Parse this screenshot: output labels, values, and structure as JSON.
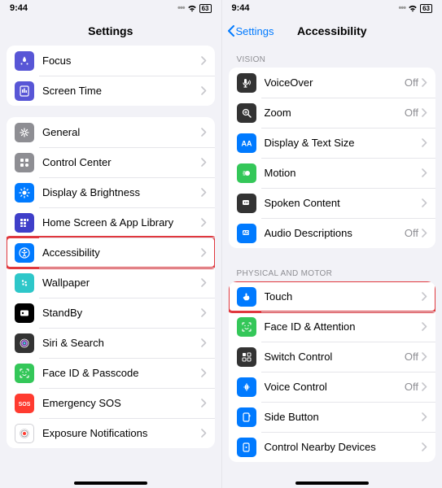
{
  "left": {
    "status": {
      "time": "9:44",
      "battery": "63"
    },
    "nav": {
      "title": "Settings"
    },
    "group1": [
      {
        "name": "focus",
        "label": "Focus",
        "iconBg": "#5856d6",
        "highlight": false
      },
      {
        "name": "screen-time",
        "label": "Screen Time",
        "iconBg": "#5856d6",
        "highlight": false
      }
    ],
    "group2": [
      {
        "name": "general",
        "label": "General",
        "iconBg": "#8e8e93",
        "highlight": false
      },
      {
        "name": "control-center",
        "label": "Control Center",
        "iconBg": "#8e8e93",
        "highlight": false
      },
      {
        "name": "display-brightness",
        "label": "Display & Brightness",
        "iconBg": "#007aff",
        "highlight": false
      },
      {
        "name": "home-screen",
        "label": "Home Screen & App Library",
        "iconBg": "#3f3fc9",
        "highlight": false
      },
      {
        "name": "accessibility",
        "label": "Accessibility",
        "iconBg": "#007aff",
        "highlight": true
      },
      {
        "name": "wallpaper",
        "label": "Wallpaper",
        "iconBg": "#2ec7c9",
        "highlight": false
      },
      {
        "name": "standby",
        "label": "StandBy",
        "iconBg": "#000000",
        "highlight": false
      },
      {
        "name": "siri-search",
        "label": "Siri & Search",
        "iconBg": "#333333",
        "highlight": false
      },
      {
        "name": "faceid-passcode",
        "label": "Face ID & Passcode",
        "iconBg": "#34c759",
        "highlight": false
      },
      {
        "name": "emergency-sos",
        "label": "Emergency SOS",
        "iconBg": "#ff3b30",
        "highlight": false
      },
      {
        "name": "exposure-notifications",
        "label": "Exposure Notifications",
        "iconBg": "#ffffff",
        "highlight": false
      }
    ]
  },
  "right": {
    "status": {
      "time": "9:44",
      "battery": "63"
    },
    "nav": {
      "back": "Settings",
      "title": "Accessibility"
    },
    "section1_title": "Vision",
    "section1": [
      {
        "name": "voiceover",
        "label": "VoiceOver",
        "value": "Off",
        "iconBg": "#333333",
        "highlight": false
      },
      {
        "name": "zoom",
        "label": "Zoom",
        "value": "Off",
        "iconBg": "#333333",
        "highlight": false
      },
      {
        "name": "display-text-size",
        "label": "Display & Text Size",
        "value": "",
        "iconBg": "#007aff",
        "highlight": false
      },
      {
        "name": "motion",
        "label": "Motion",
        "value": "",
        "iconBg": "#34c759",
        "highlight": false
      },
      {
        "name": "spoken-content",
        "label": "Spoken Content",
        "value": "",
        "iconBg": "#333333",
        "highlight": false
      },
      {
        "name": "audio-descriptions",
        "label": "Audio Descriptions",
        "value": "Off",
        "iconBg": "#007aff",
        "highlight": false
      }
    ],
    "section2_title": "Physical and Motor",
    "section2": [
      {
        "name": "touch",
        "label": "Touch",
        "value": "",
        "iconBg": "#007aff",
        "highlight": true
      },
      {
        "name": "faceid-attention",
        "label": "Face ID & Attention",
        "value": "",
        "iconBg": "#34c759",
        "highlight": false
      },
      {
        "name": "switch-control",
        "label": "Switch Control",
        "value": "Off",
        "iconBg": "#333333",
        "highlight": false
      },
      {
        "name": "voice-control",
        "label": "Voice Control",
        "value": "Off",
        "iconBg": "#007aff",
        "highlight": false
      },
      {
        "name": "side-button",
        "label": "Side Button",
        "value": "",
        "iconBg": "#007aff",
        "highlight": false
      },
      {
        "name": "control-nearby",
        "label": "Control Nearby Devices",
        "value": "",
        "iconBg": "#007aff",
        "highlight": false
      }
    ]
  },
  "colors": {
    "highlight": "#e0383e",
    "link": "#007aff",
    "secondary": "#8e8e93"
  }
}
